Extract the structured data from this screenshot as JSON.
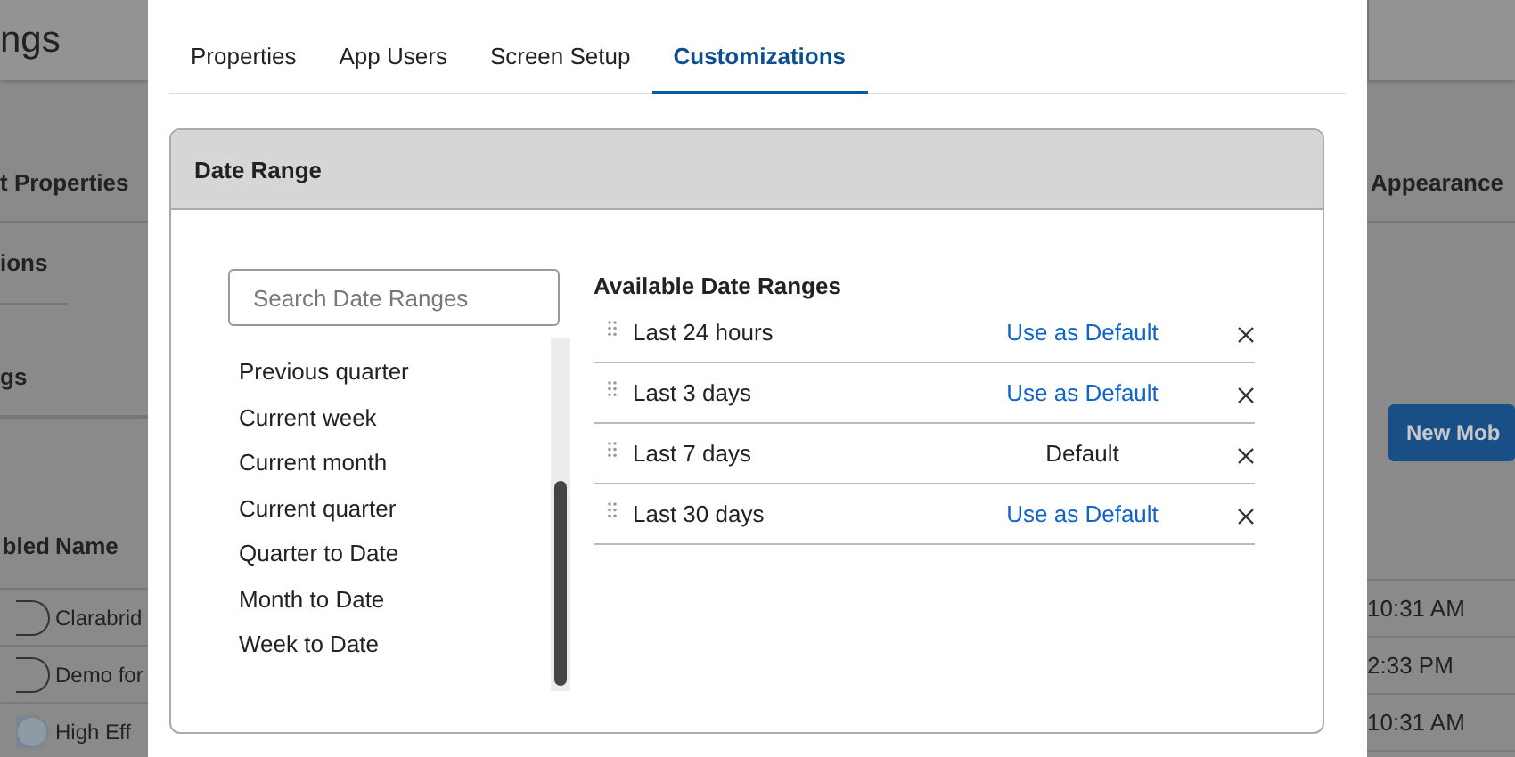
{
  "background_page": {
    "title": "ngs",
    "left_labels": [
      "t Properties",
      "ions",
      "gs"
    ],
    "column_headers": [
      "bled",
      "Name"
    ],
    "rows": [
      {
        "on": false,
        "name": "Clarabrid",
        "time": "10:31 AM"
      },
      {
        "on": false,
        "name": "Demo for",
        "time": "2:33 PM"
      },
      {
        "on": true,
        "name": "High Eff",
        "time": "10:31 AM"
      }
    ],
    "right_label": "Appearance",
    "new_button": "New Mob"
  },
  "tabs": [
    {
      "label": "Properties",
      "selected": false
    },
    {
      "label": "App Users",
      "selected": false
    },
    {
      "label": "Screen Setup",
      "selected": false
    },
    {
      "label": "Customizations",
      "selected": true
    }
  ],
  "panel": {
    "title": "Date Range",
    "search": {
      "placeholder": "Search Date Ranges"
    },
    "options": [
      "Previous quarter",
      "Current week",
      "Current month",
      "Current quarter",
      "Quarter to Date",
      "Month to Date",
      "Week to Date"
    ],
    "available_title": "Available Date Ranges",
    "available": [
      {
        "label": "Last 24 hours",
        "is_default": false,
        "action": "Use as Default"
      },
      {
        "label": "Last 3 days",
        "is_default": false,
        "action": "Use as Default"
      },
      {
        "label": "Last 7 days",
        "is_default": true,
        "action": "Default"
      },
      {
        "label": "Last 30 days",
        "is_default": false,
        "action": "Use as Default"
      }
    ]
  }
}
